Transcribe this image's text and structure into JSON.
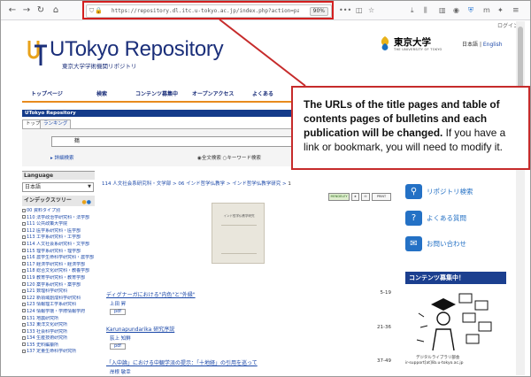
{
  "browser": {
    "url": "https://repository.dl.itc.u-tokyo.ac.jp/index.php?action=pages_view_main&active_action=",
    "zoom": "90%"
  },
  "header": {
    "login": "ログイン",
    "site_title": "UTokyo Repository",
    "site_subtitle": "東京大学学術機関リポジトリ",
    "univ_name_ja": "東京大学",
    "univ_name_en": "THE UNIVERSITY OF TOKYO",
    "lang_ja": "日本語",
    "lang_sep": "|",
    "lang_en": "English"
  },
  "topnav": [
    "トップページ",
    "検索",
    "コンテンツ募集中",
    "オープンアクセス",
    "よくある"
  ],
  "module": {
    "title": "UTokyo Repository",
    "tabs": [
      "トップ",
      "ランキング"
    ]
  },
  "search": {
    "value": "鶴",
    "option_full": "全文検索",
    "option_keyword": "キーワード検索",
    "detail_link": "詳細検索"
  },
  "sidebar": {
    "language_title": "Language",
    "language_value": "日本語",
    "index_title": "インデックスツリー",
    "index_items": [
      "00 資料タイプ別",
      "110 法学政治学研究科・法学部",
      "111 公共政策大学院",
      "112 医学系研究科・医学部",
      "113 工学系研究科・工学部",
      "114 人文社会系研究科・文学部",
      "115 理学系研究科・理学部",
      "116 農学生命科学研究科・農学部",
      "117 経済学研究科・経済学部",
      "118 総合文化研究科・教養学部",
      "119 教育学研究科・教育学部",
      "120 薬学系研究科・薬学部",
      "121 数理科学研究科",
      "122 新領域創成科学研究科",
      "123 情報理工学系研究科",
      "124 情報学環・学際情報学府",
      "131 地震研究所",
      "132 東洋文化研究所",
      "133 社会科学研究所",
      "134 生産技術研究所",
      "135 史料編纂所",
      "137 定量生命科学研究所"
    ]
  },
  "breadcrumb": {
    "items": [
      "114 人文社会系研究科・文学部",
      "06 インド哲学仏教学",
      "インド哲学仏教学研究"
    ],
    "current": "1",
    "sep": ">"
  },
  "cover": {
    "caption": "インド哲学仏教学研究"
  },
  "feature_icons": [
    "MENDELEY",
    "PRINT"
  ],
  "articles": [
    {
      "title": "ディグナーガにおける\"内色\"と\"外縁\"",
      "pages": "5-19",
      "author": "上田 昇",
      "pdf": "pdf"
    },
    {
      "title": "Karunapundarika 研究序説",
      "pages": "21-36",
      "author": "荻上 知鮮",
      "pdf": "pdf"
    },
    {
      "title": "「入中論」における中観学派の提示：「十地経」の引用を巡って",
      "pages": "37-49",
      "author": "岸根 敏幸",
      "pdf": ""
    }
  ],
  "right_sidebar": {
    "links": [
      "リポジトリ検索",
      "よくある質問",
      "お問い合わせ"
    ],
    "content_head": "コンテンツ募集中！",
    "illus_caption": "デジタルライブラリ部会",
    "illus_mail": "ir-support[at]lib.u-tokyo.ac.jp"
  },
  "callout": {
    "bold": "The URLs of the title pages and table of contents pages of bulletins and each publication will be changed.",
    "normal": " If you have a link or bookmark, you will need to modify it."
  },
  "colors": {
    "highlight_red": "#d32020",
    "brand_blue": "#1b2f7a",
    "link_blue": "#1a47a8",
    "accent_orange": "#e88b1e"
  }
}
